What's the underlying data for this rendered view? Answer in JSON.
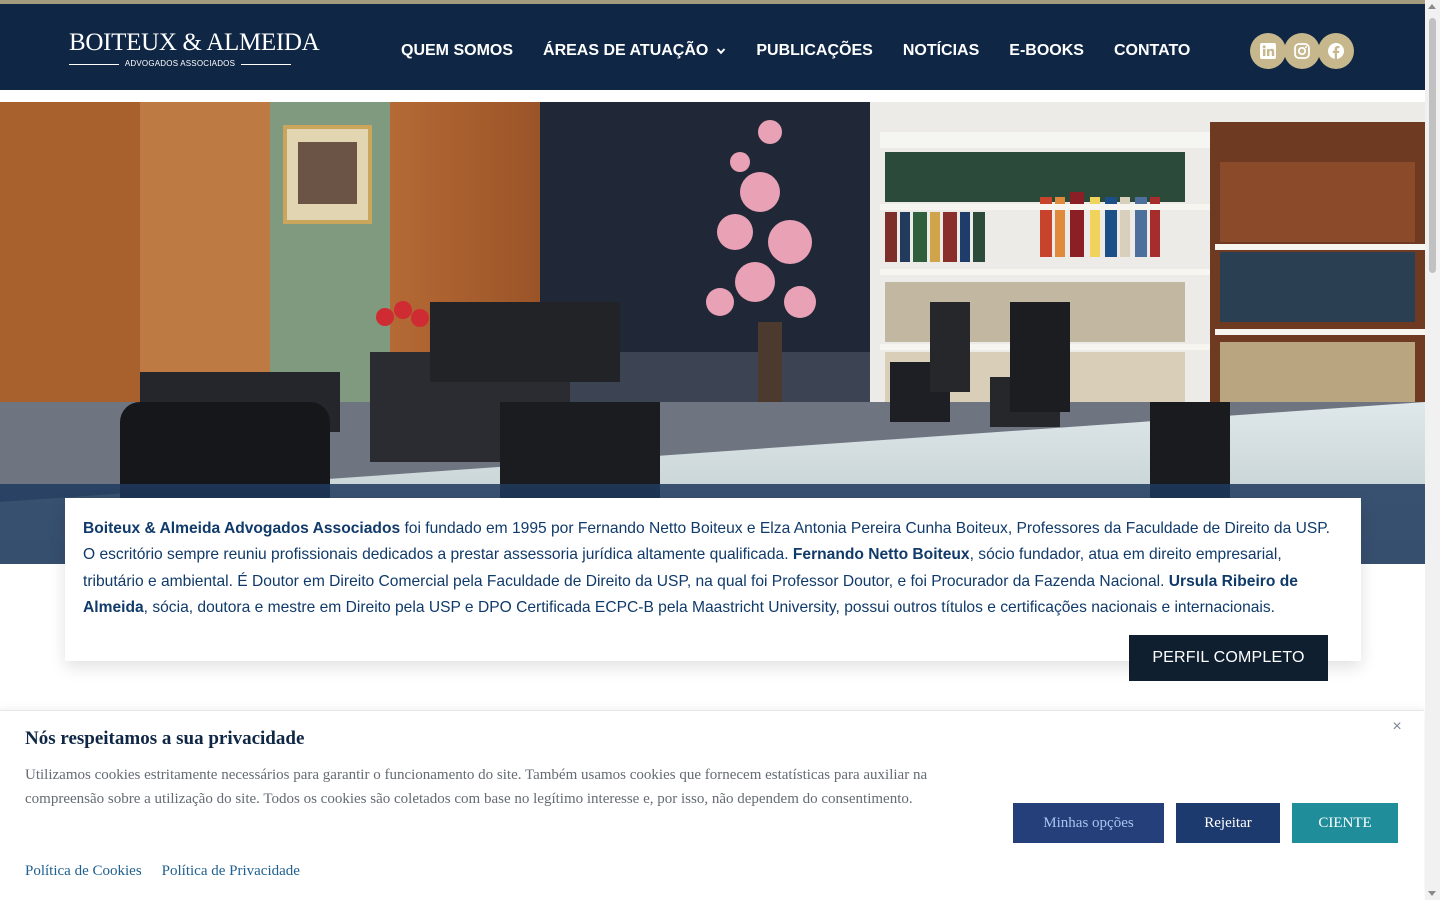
{
  "header": {
    "logo": {
      "main": "BOITEUX & ALMEIDA",
      "sub": "ADVOGADOS ASSOCIADOS"
    },
    "nav": [
      {
        "label": "QUEM SOMOS"
      },
      {
        "label": "ÁREAS DE ATUAÇÃO",
        "has_dropdown": true
      },
      {
        "label": "PUBLICAÇÕES"
      },
      {
        "label": "NOTÍCIAS"
      },
      {
        "label": "E-BOOKS"
      },
      {
        "label": "CONTATO"
      }
    ],
    "social": [
      "linkedin-icon",
      "instagram-icon",
      "facebook-icon"
    ]
  },
  "intro": {
    "firm_name": "Boiteux & Almeida Advogados Associados",
    "text_1": " foi fundado em 1995 por Fernando Netto Boiteux e Elza Antonia Pereira Cunha Boiteux, Professores da Faculdade de Direito da USP. O escritório sempre reuniu profissionais dedicados a prestar assessoria jurídica altamente qualificada. ",
    "partner_1": "Fernando Netto Boiteux",
    "text_2": ", sócio fundador, atua em direito empresarial, tributário e ambiental. É Doutor em Direito Comercial pela Faculdade de Direito da USP, na qual foi Professor Doutor, e foi Procurador da Fazenda Nacional. ",
    "partner_2": "Ursula Ribeiro de Almeida",
    "text_3": ", sócia, doutora e mestre em Direito pela USP e DPO Certificada ECPC-B pela Maastricht University, possui outros títulos e certificações nacionais e internacionais.",
    "button": "PERFIL COMPLETO"
  },
  "cookie": {
    "title": "Nós respeitamos a sua privacidade",
    "close": "×",
    "body": "Utilizamos cookies estritamente necessários para garantir o funcionamento do site. Também usamos cookies que fornecem estatísticas para auxiliar na compreensão sobre a utilização do site. Todos os cookies são coletados com base no legítimo interesse e, por isso, não dependem do consentimento.",
    "links": [
      "Política de Cookies",
      "Política de Privacidade"
    ],
    "buttons": {
      "options": "Minhas opções",
      "reject": "Rejeitar",
      "accept": "CIENTE"
    }
  },
  "colors": {
    "header_bg": "#0f2745",
    "gold": "#c6b78c",
    "text_blue": "#103a6a",
    "accept_teal": "#1f8e9a"
  }
}
